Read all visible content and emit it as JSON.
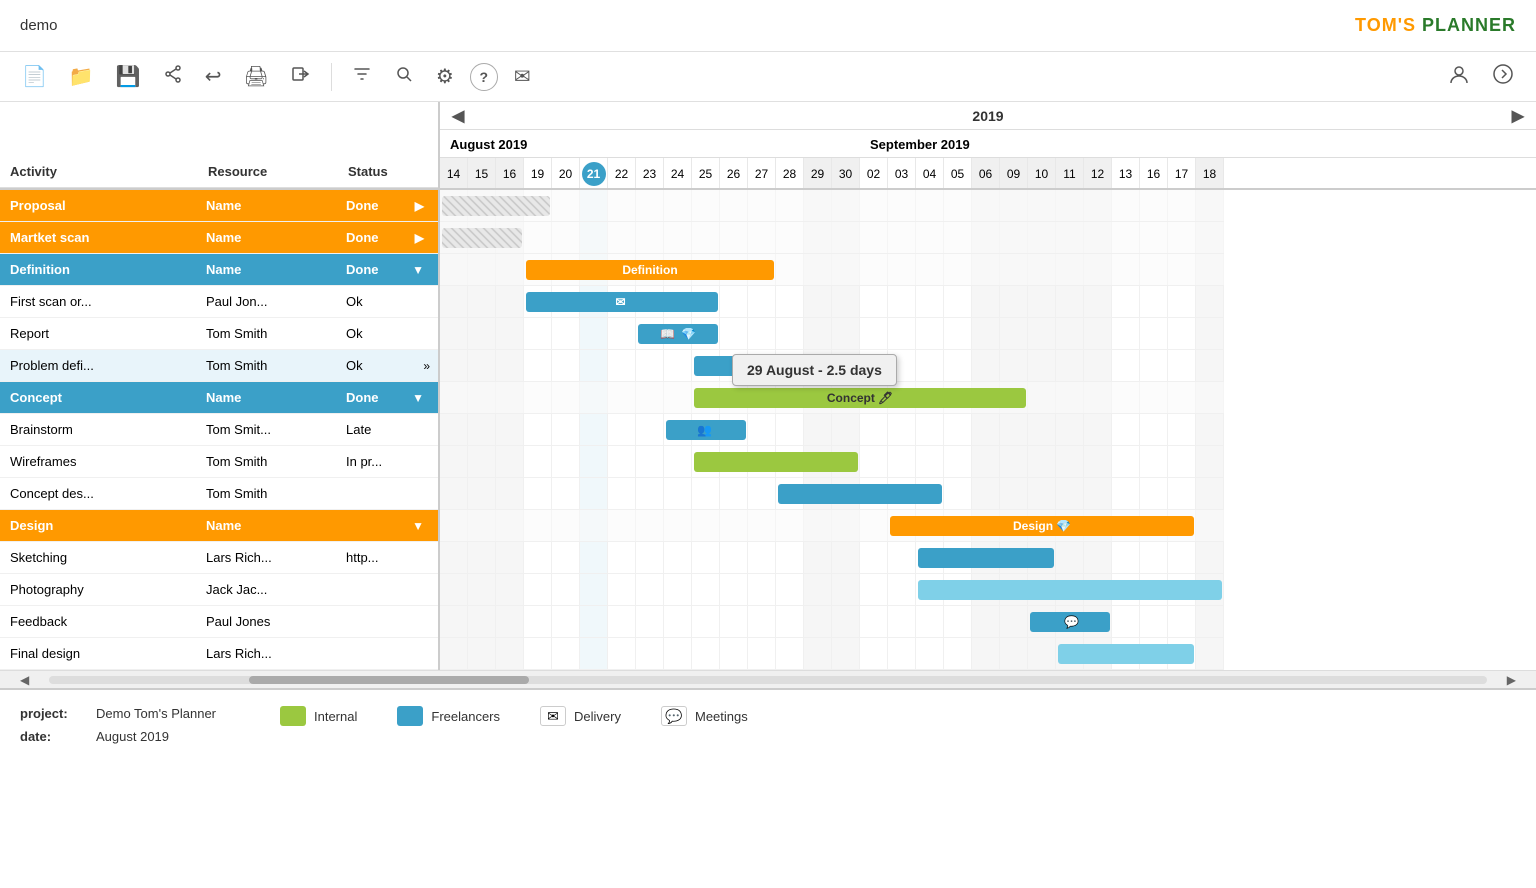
{
  "app": {
    "demo_label": "demo",
    "brand_toms": "TOM'S",
    "brand_planner": " PLANNER"
  },
  "toolbar": {
    "tools": [
      {
        "name": "new-file-icon",
        "icon": "📄"
      },
      {
        "name": "folder-icon",
        "icon": "📁"
      },
      {
        "name": "save-icon",
        "icon": "💾"
      },
      {
        "name": "share-icon",
        "icon": "🔗"
      },
      {
        "name": "undo-icon",
        "icon": "↩"
      },
      {
        "name": "print-icon",
        "icon": "🖨"
      },
      {
        "name": "login-icon",
        "icon": "🔑"
      },
      {
        "name": "filter-icon",
        "icon": "▽"
      },
      {
        "name": "search-icon",
        "icon": "🔍"
      },
      {
        "name": "settings-icon",
        "icon": "⚙"
      },
      {
        "name": "help-icon",
        "icon": "?"
      },
      {
        "name": "mail-icon",
        "icon": "✉"
      }
    ],
    "right_tools": [
      {
        "name": "user-icon",
        "icon": "👤"
      },
      {
        "name": "forward-icon",
        "icon": "→"
      }
    ]
  },
  "header_columns": {
    "activity": "Activity",
    "resource": "Resource",
    "status": "Status"
  },
  "rows": [
    {
      "type": "group",
      "color": "orange",
      "activity": "Proposal",
      "resource": "Name",
      "status": "Done",
      "expand": "▶"
    },
    {
      "type": "group",
      "color": "orange",
      "activity": "Martket scan",
      "resource": "Name",
      "status": "Done",
      "expand": "▶"
    },
    {
      "type": "group",
      "color": "blue-selected",
      "activity": "Definition",
      "resource": "Name",
      "status": "Done",
      "expand": "▼"
    },
    {
      "type": "sub",
      "activity": "First scan or...",
      "resource": "Paul Jon...",
      "status": "Ok"
    },
    {
      "type": "sub",
      "activity": "Report",
      "resource": "Tom Smith",
      "status": "Ok"
    },
    {
      "type": "sub",
      "special": true,
      "activity": "Problem defi...",
      "resource": "Tom Smith",
      "status": "Ok",
      "extra": "»"
    },
    {
      "type": "group",
      "color": "blue-selected",
      "activity": "Concept",
      "resource": "Name",
      "status": "Done",
      "expand": "▼"
    },
    {
      "type": "sub",
      "activity": "Brainstorm",
      "resource": "Tom Smit...",
      "status": "Late"
    },
    {
      "type": "sub",
      "activity": "Wireframes",
      "resource": "Tom Smith",
      "status": "In pr..."
    },
    {
      "type": "sub",
      "activity": "Concept des...",
      "resource": "Tom Smith",
      "status": ""
    },
    {
      "type": "group",
      "color": "orange",
      "activity": "Design",
      "resource": "Name",
      "status": "",
      "expand": "▼"
    },
    {
      "type": "sub",
      "activity": "Sketching",
      "resource": "Lars Rich...",
      "status": "http..."
    },
    {
      "type": "sub",
      "activity": "Photography",
      "resource": "Jack Jac...",
      "status": ""
    },
    {
      "type": "sub",
      "activity": "Feedback",
      "resource": "Paul Jones",
      "status": ""
    },
    {
      "type": "sub",
      "activity": "Final design",
      "resource": "Lars Rich...",
      "status": ""
    }
  ],
  "gantt": {
    "year": "2019",
    "months": [
      {
        "label": "August 2019",
        "col_start": 0,
        "col_span": 12
      },
      {
        "label": "September 2019",
        "col_start": 12,
        "col_span": 8
      }
    ],
    "days": [
      "14",
      "15",
      "16",
      "19",
      "20",
      "21",
      "22",
      "23",
      "24",
      "25",
      "26",
      "27",
      "28",
      "29",
      "30",
      "02",
      "03",
      "04",
      "05",
      "06",
      "09",
      "10",
      "11",
      "12",
      "13",
      "16",
      "17",
      "18"
    ],
    "today_idx": 5,
    "weekend_indices": [
      0,
      1,
      2,
      13,
      14,
      19,
      20,
      21,
      22,
      23,
      27
    ],
    "bars": [
      {
        "row": 0,
        "start": 0,
        "width": 4,
        "type": "hatch",
        "label": ""
      },
      {
        "row": 1,
        "start": 0,
        "width": 3,
        "type": "hatch",
        "label": ""
      },
      {
        "row": 2,
        "start": 3,
        "width": 9,
        "type": "orange",
        "label": "Definition",
        "icon_right": ""
      },
      {
        "row": 3,
        "start": 3,
        "width": 7,
        "type": "blue",
        "label": "",
        "icon_left": "✉"
      },
      {
        "row": 4,
        "start": 7,
        "width": 3,
        "type": "blue",
        "label": "",
        "icon_left": "📖",
        "icon_right": "💎"
      },
      {
        "row": 5,
        "start": 9,
        "width": 3,
        "type": "blue",
        "label": ""
      },
      {
        "row": 6,
        "start": 9,
        "width": 12,
        "type": "green",
        "label": "Concept",
        "icon_right": "🖊"
      },
      {
        "row": 7,
        "start": 8,
        "width": 3,
        "type": "blue",
        "label": "",
        "icon_left": "👥"
      },
      {
        "row": 8,
        "start": 9,
        "width": 6,
        "type": "green",
        "label": ""
      },
      {
        "row": 9,
        "start": 12,
        "width": 6,
        "type": "blue",
        "label": ""
      },
      {
        "row": 10,
        "start": 16,
        "width": 11,
        "type": "orange",
        "label": "Design",
        "icon_right": "💎"
      },
      {
        "row": 11,
        "start": 17,
        "width": 5,
        "type": "blue",
        "label": ""
      },
      {
        "row": 12,
        "start": 17,
        "width": 11,
        "type": "light-blue",
        "label": ""
      },
      {
        "row": 13,
        "start": 21,
        "width": 3,
        "type": "blue",
        "label": "",
        "icon_right": "💬"
      },
      {
        "row": 14,
        "start": 22,
        "width": 5,
        "type": "light-blue",
        "label": ""
      }
    ]
  },
  "tooltip": {
    "text": "29 August - 2.5 days"
  },
  "footer": {
    "project_label": "project:",
    "project_value": "Demo Tom's Planner",
    "date_label": "date:",
    "date_value": "August 2019",
    "legend": [
      {
        "color": "#9bc840",
        "label": "Internal"
      },
      {
        "color": "#3ba0c8",
        "label": "Freelancers"
      },
      {
        "color": "#ddd",
        "label": "Delivery",
        "icon": "✉"
      },
      {
        "color": "#7fd0e8",
        "label": "Meetings",
        "icon": "💬"
      }
    ]
  },
  "scrollbar": {
    "left_arrow": "◀",
    "right_arrow": "▶"
  }
}
